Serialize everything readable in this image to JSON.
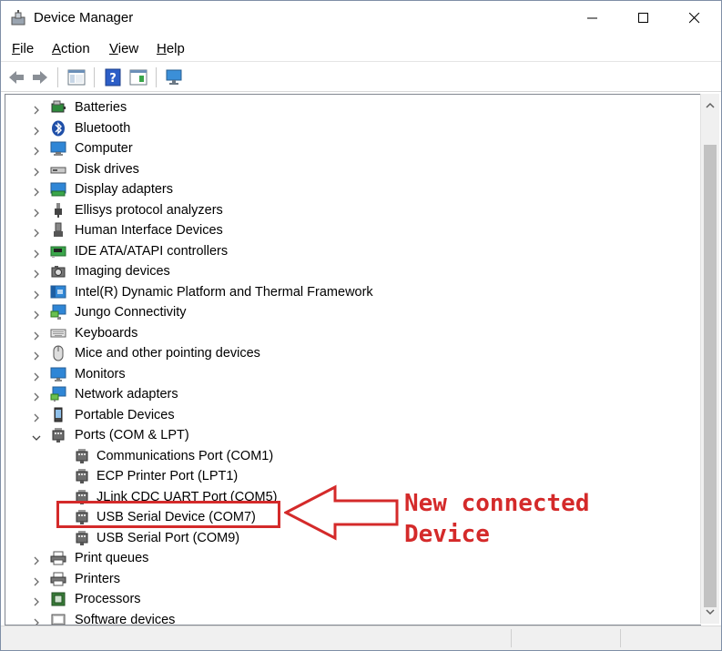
{
  "window": {
    "title": "Device Manager",
    "icon": "device-manager-icon"
  },
  "menu": [
    {
      "label": "File"
    },
    {
      "label": "Action"
    },
    {
      "label": "View"
    },
    {
      "label": "Help"
    }
  ],
  "toolbar": [
    "back-arrow-icon",
    "forward-arrow-icon",
    "show-hide-tree-icon",
    "help-icon",
    "properties-icon",
    "scan-hardware-icon"
  ],
  "tree": {
    "items": [
      {
        "label": "Batteries",
        "icon": "battery-icon",
        "state": "collapsed"
      },
      {
        "label": "Bluetooth",
        "icon": "bluetooth-icon",
        "state": "collapsed"
      },
      {
        "label": "Computer",
        "icon": "computer-icon",
        "state": "collapsed"
      },
      {
        "label": "Disk drives",
        "icon": "disk-drive-icon",
        "state": "collapsed"
      },
      {
        "label": "Display adapters",
        "icon": "display-adapter-icon",
        "state": "collapsed"
      },
      {
        "label": "Ellisys protocol analyzers",
        "icon": "usb-plug-icon",
        "state": "collapsed"
      },
      {
        "label": "Human Interface Devices",
        "icon": "hid-icon",
        "state": "collapsed"
      },
      {
        "label": "IDE ATA/ATAPI controllers",
        "icon": "ide-controller-icon",
        "state": "collapsed"
      },
      {
        "label": "Imaging devices",
        "icon": "camera-icon",
        "state": "collapsed"
      },
      {
        "label": "Intel(R) Dynamic Platform and Thermal Framework",
        "icon": "chip-board-icon",
        "state": "collapsed"
      },
      {
        "label": "Jungo Connectivity",
        "icon": "network-monitor-icon",
        "state": "collapsed"
      },
      {
        "label": "Keyboards",
        "icon": "keyboard-icon",
        "state": "collapsed"
      },
      {
        "label": "Mice and other pointing devices",
        "icon": "mouse-icon",
        "state": "collapsed"
      },
      {
        "label": "Monitors",
        "icon": "monitor-icon",
        "state": "collapsed"
      },
      {
        "label": "Network adapters",
        "icon": "network-adapter-icon",
        "state": "collapsed"
      },
      {
        "label": "Portable Devices",
        "icon": "portable-device-icon",
        "state": "collapsed"
      },
      {
        "label": "Ports (COM & LPT)",
        "icon": "port-icon",
        "state": "expanded"
      },
      {
        "label": "Communications Port (COM1)",
        "icon": "port-icon",
        "state": "child"
      },
      {
        "label": "ECP Printer Port (LPT1)",
        "icon": "port-icon",
        "state": "child"
      },
      {
        "label": "JLink CDC UART Port (COM5)",
        "icon": "port-icon",
        "state": "child"
      },
      {
        "label": "USB Serial Device (COM7)",
        "icon": "port-icon",
        "state": "child"
      },
      {
        "label": "USB Serial Port (COM9)",
        "icon": "port-icon",
        "state": "child"
      },
      {
        "label": "Print queues",
        "icon": "printer-icon",
        "state": "collapsed"
      },
      {
        "label": "Printers",
        "icon": "printer-icon",
        "state": "collapsed"
      },
      {
        "label": "Processors",
        "icon": "processor-icon",
        "state": "collapsed"
      },
      {
        "label": "Software devices",
        "icon": "software-device-icon",
        "state": "collapsed"
      }
    ]
  },
  "annotation": {
    "line1": "New connected",
    "line2": "Device",
    "color": "#d42a2a"
  }
}
